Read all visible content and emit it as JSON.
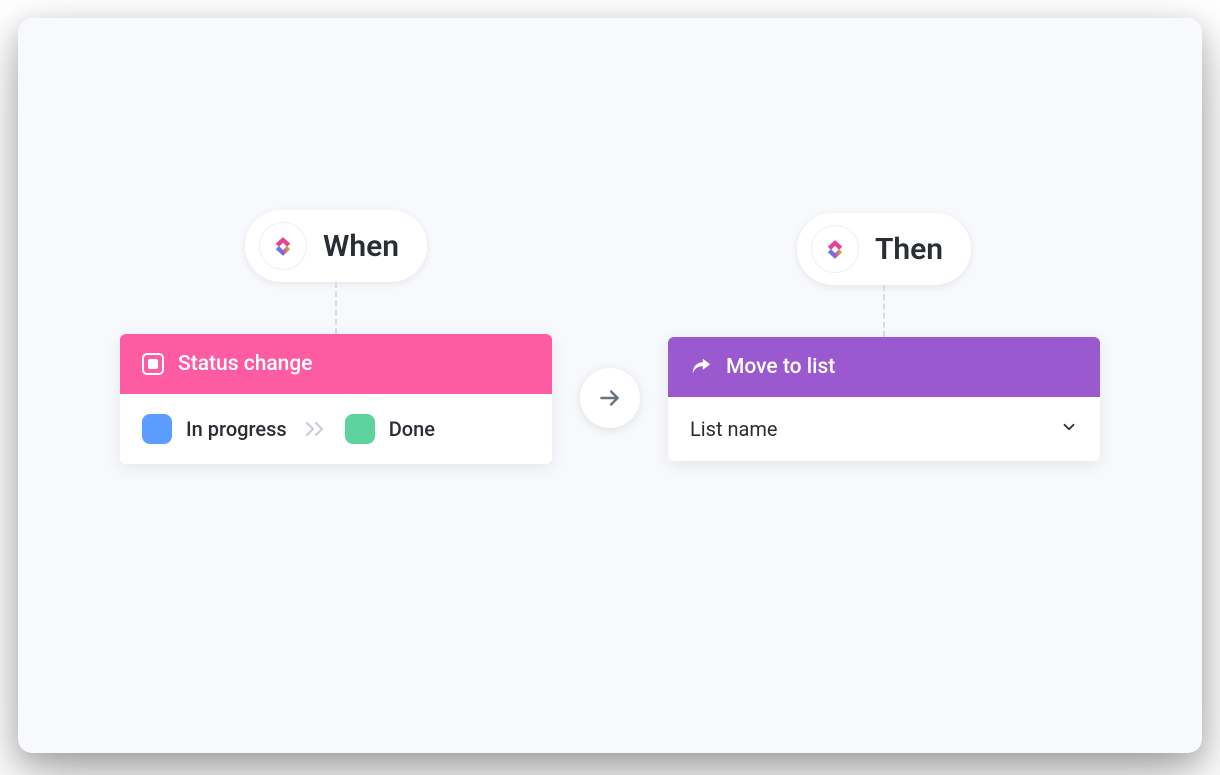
{
  "when": {
    "pill_label": "When",
    "header_label": "Status change",
    "from_status": "In progress",
    "to_status": "Done"
  },
  "then": {
    "pill_label": "Then",
    "header_label": "Move to list",
    "select_placeholder": "List name"
  }
}
